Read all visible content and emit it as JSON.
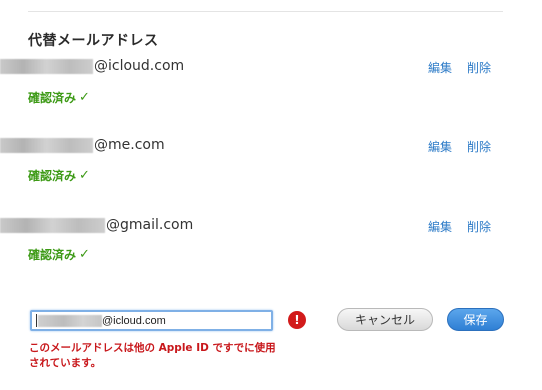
{
  "section": {
    "title": "代替メールアドレス"
  },
  "emails": [
    {
      "domain": "@icloud.com",
      "status": "確認済み",
      "edit_label": "編集",
      "delete_label": "削除"
    },
    {
      "domain": "@me.com",
      "status": "確認済み",
      "edit_label": "編集",
      "delete_label": "削除"
    },
    {
      "domain": "@gmail.com",
      "status": "確認済み",
      "edit_label": "編集",
      "delete_label": "削除"
    }
  ],
  "check_mark": "✓",
  "new_email": {
    "value": "@icloud.com"
  },
  "error": {
    "icon": "!",
    "message_line1": "このメールアドレスは他の Apple ID ですでに使用",
    "message_line2": "されています。"
  },
  "buttons": {
    "cancel_label": "キャンセル",
    "save_label": "保存"
  },
  "colors": {
    "link": "#2b7ac7",
    "verified": "#3d9a16",
    "error": "#c8171b",
    "primary_button": "#2f7fd4"
  }
}
